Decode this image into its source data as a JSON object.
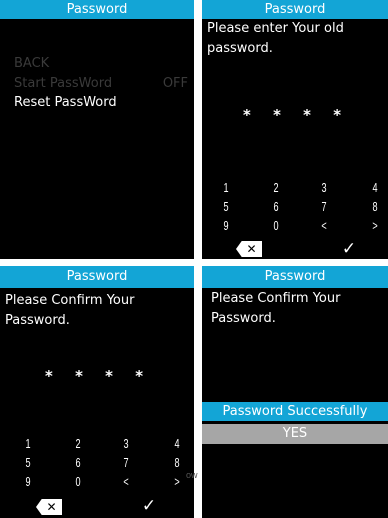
{
  "screens": [
    {
      "header": "Password",
      "menu": [
        {
          "label": "BACK",
          "value": ""
        },
        {
          "label": "Start PassWord",
          "value": "OFF"
        },
        {
          "label": "Reset PassWord",
          "value": ""
        }
      ]
    },
    {
      "header": "Password",
      "prompt": "Please enter Your old password.",
      "masked_input": "* * * *",
      "keypad": [
        "1",
        "2",
        "3",
        "4",
        "5",
        "6",
        "7",
        "8",
        "9",
        "0",
        "<",
        ">"
      ],
      "delete_key": "✕",
      "confirm_key": "✓"
    },
    {
      "header": "Password",
      "prompt": "Please Confirm Your Password.",
      "masked_input": "* * * *",
      "keypad": [
        "1",
        "2",
        "3",
        "4",
        "5",
        "6",
        "7",
        "8",
        "9",
        "0",
        "<",
        ">"
      ],
      "delete_key": "✕",
      "confirm_key": "✓"
    },
    {
      "header": "Password",
      "prompt": "Please Confirm Your Password.",
      "banner": "Password Successfully",
      "yes_button": "YES"
    }
  ],
  "watermark": "ow",
  "colors": {
    "header_bg": "#13a5d6",
    "screen_bg": "#000000",
    "dim_text": "#3a3a3a",
    "yes_bg": "#a6a6a6"
  }
}
